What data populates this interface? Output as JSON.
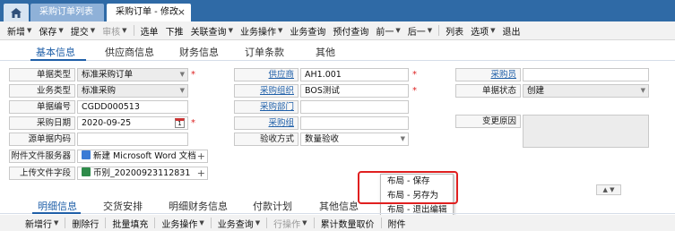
{
  "tabs": {
    "list_label": "采购订单列表",
    "active_label": "采购订单 - 修改",
    "close_glyph": "×"
  },
  "toolbar": [
    {
      "label": "新增",
      "caret": true,
      "disabled": false
    },
    {
      "label": "保存",
      "caret": true,
      "disabled": false
    },
    {
      "label": "提交",
      "caret": true,
      "disabled": false
    },
    {
      "label": "审核",
      "caret": true,
      "disabled": true
    },
    {
      "sep": true
    },
    {
      "label": "选单",
      "caret": false,
      "disabled": false
    },
    {
      "label": "下推",
      "caret": false,
      "disabled": false
    },
    {
      "label": "关联查询",
      "caret": true,
      "disabled": false
    },
    {
      "label": "业务操作",
      "caret": true,
      "disabled": false
    },
    {
      "label": "业务查询",
      "caret": false,
      "disabled": false
    },
    {
      "label": "预付查询",
      "caret": false,
      "disabled": false
    },
    {
      "label": "前一",
      "caret": true,
      "disabled": false
    },
    {
      "label": "后一",
      "caret": true,
      "disabled": false
    },
    {
      "sep": true
    },
    {
      "label": "列表",
      "caret": false,
      "disabled": false
    },
    {
      "label": "选项",
      "caret": true,
      "disabled": false
    },
    {
      "label": "退出",
      "caret": false,
      "disabled": false
    }
  ],
  "section_tabs": [
    "基本信息",
    "供应商信息",
    "财务信息",
    "订单条款",
    "其他"
  ],
  "form": {
    "bill_type": {
      "label": "单据类型",
      "value": "标准采购订单"
    },
    "biz_type": {
      "label": "业务类型",
      "value": "标准采购"
    },
    "bill_no": {
      "label": "单据编号",
      "value": "CGDD000513"
    },
    "purchase_date": {
      "label": "采购日期",
      "value": "2020-09-25"
    },
    "source_content": {
      "label": "源单据内码",
      "value": ""
    },
    "attach_server": {
      "label": "附件文件服务器",
      "value": "新建 Microsoft Word 文档"
    },
    "upload_field": {
      "label": "上传文件字段",
      "value": "币别_20200923112831"
    },
    "supplier": {
      "label": "供应商",
      "value": "AH1.001"
    },
    "purchase_org": {
      "label": "采购组织",
      "value": "BOS测试"
    },
    "purchase_dept": {
      "label": "采购部门",
      "value": ""
    },
    "purchase_group": {
      "label": "采购组",
      "value": ""
    },
    "inspection": {
      "label": "验收方式",
      "value": "数量验收"
    },
    "purchaser": {
      "label": "采购员",
      "value": ""
    },
    "bill_status": {
      "label": "单据状态",
      "value": "创建"
    },
    "change_reason": {
      "label": "变更原因",
      "value": ""
    },
    "required_mark": "*",
    "calendar_day": "1"
  },
  "popup": [
    "布局 - 保存",
    "布局 - 另存为",
    "布局 - 退出编辑"
  ],
  "bottom_tabs": [
    "明细信息",
    "交货安排",
    "明细财务信息",
    "付款计划",
    "其他信息"
  ],
  "bottom_toolbar": [
    {
      "label": "新增行",
      "caret": true,
      "disabled": false
    },
    {
      "label": "删除行",
      "caret": false,
      "disabled": false
    },
    {
      "label": "批量填充",
      "caret": false,
      "disabled": false
    },
    {
      "label": "业务操作",
      "caret": true,
      "disabled": false
    },
    {
      "label": "业务查询",
      "caret": true,
      "disabled": false
    },
    {
      "label": "行操作",
      "caret": true,
      "disabled": true
    },
    {
      "label": "累计数量取价",
      "caret": false,
      "disabled": false
    },
    {
      "label": "附件",
      "caret": false,
      "disabled": false
    }
  ]
}
